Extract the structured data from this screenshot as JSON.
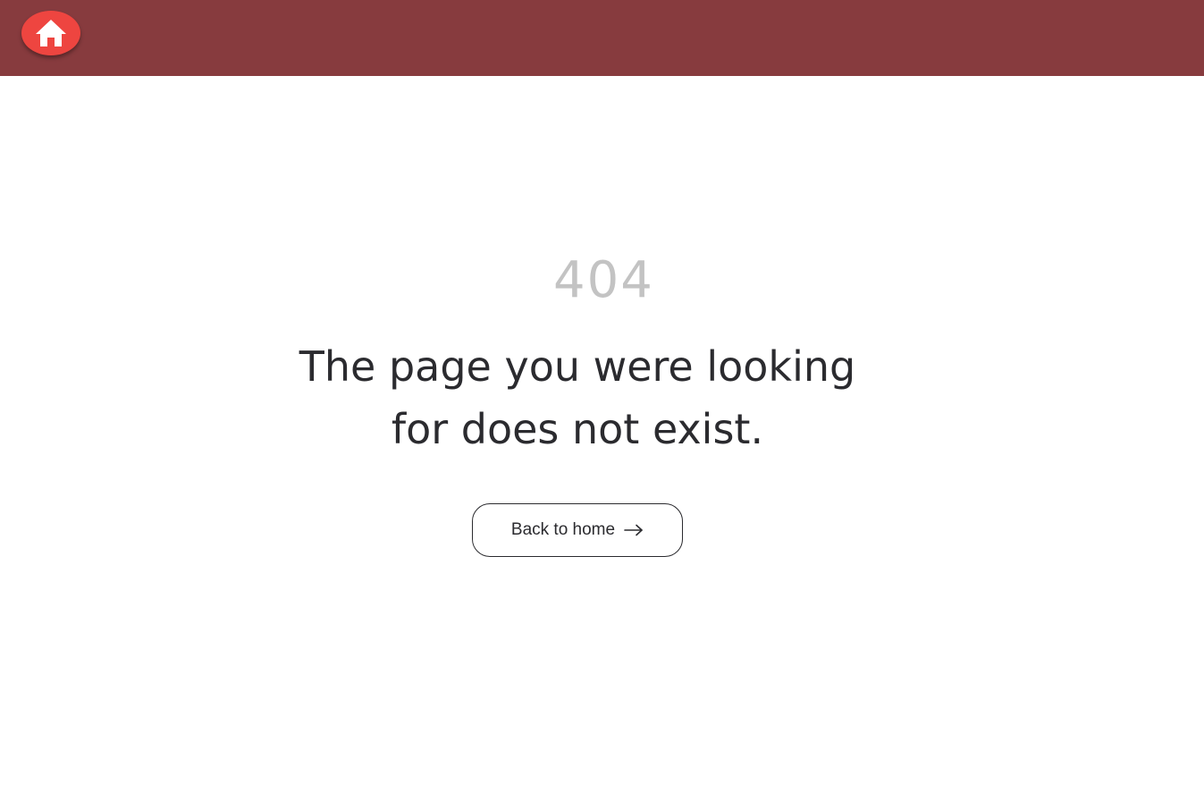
{
  "header": {
    "background_color": "#873b3e",
    "home_button": {
      "icon": "home-icon",
      "color": "#ee4540"
    }
  },
  "error": {
    "code": "404",
    "message": "The page you were looking for does not exist.",
    "code_color": "#c3c3c3",
    "text_color": "#2b2b2f"
  },
  "back_button": {
    "label": "Back to home",
    "icon": "arrow-right-icon"
  }
}
